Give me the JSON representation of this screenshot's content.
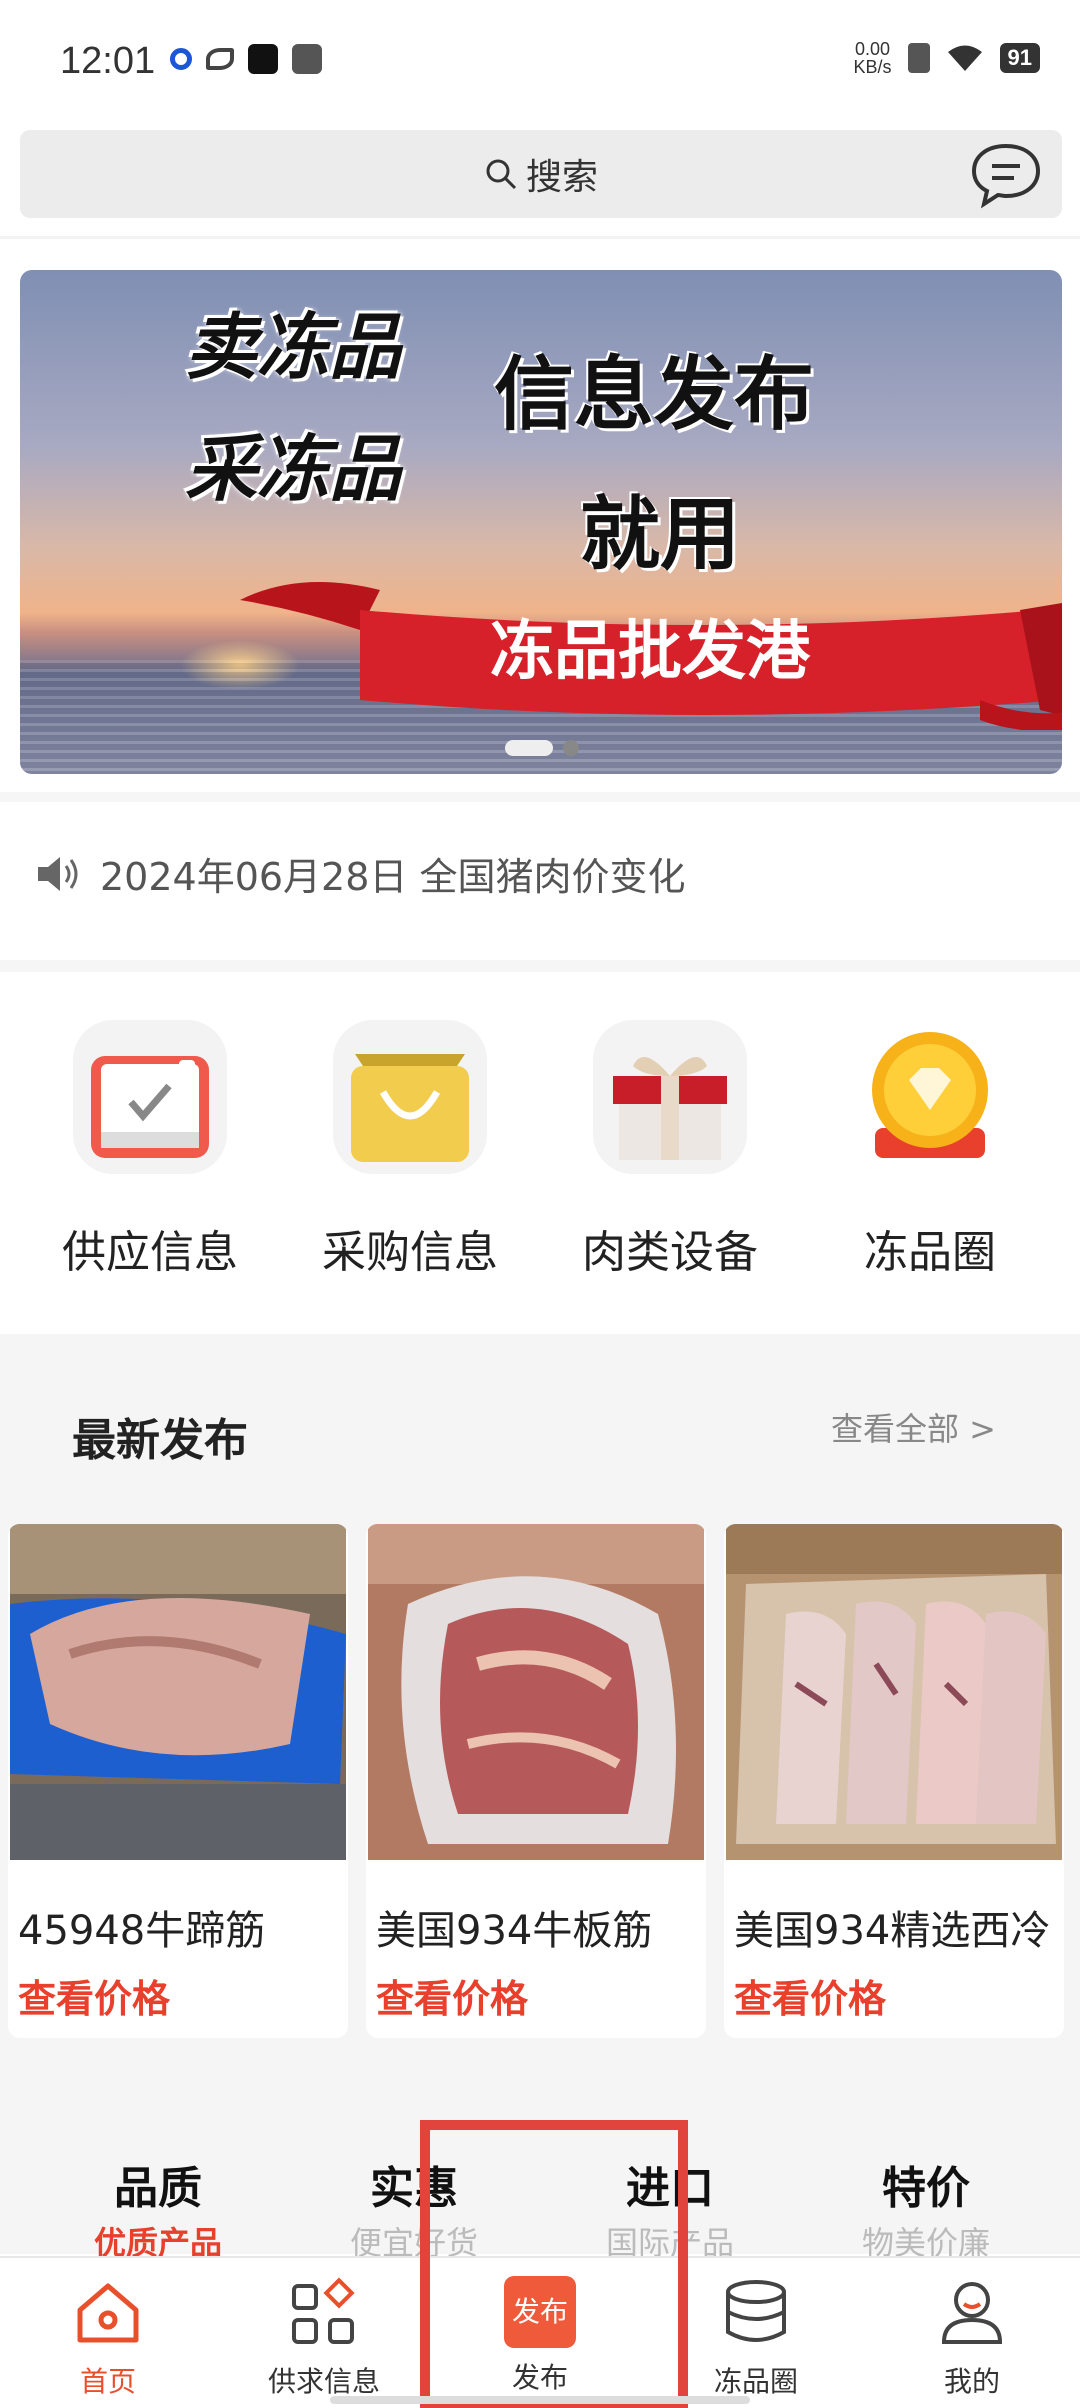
{
  "status_bar": {
    "time": "12:01",
    "net_speed_value": "0.00",
    "net_speed_unit": "KB/s",
    "battery": "91"
  },
  "search": {
    "placeholder": "搜索"
  },
  "banner": {
    "line1": "卖冻品",
    "line2": "采冻品",
    "line3": "信息发布",
    "line4": "就用",
    "ribbon": "冻品批发港"
  },
  "notice": {
    "text": "2024年06月28日 全国猪肉价变化"
  },
  "categories": [
    {
      "label": "供应信息",
      "icon": "calendar-check-icon"
    },
    {
      "label": "采购信息",
      "icon": "shopping-bag-icon"
    },
    {
      "label": "肉类设备",
      "icon": "gift-box-icon"
    },
    {
      "label": "冻品圈",
      "icon": "diamond-badge-icon"
    }
  ],
  "latest": {
    "title": "最新发布",
    "view_all": "查看全部 >",
    "items": [
      {
        "name": "45948牛蹄筋",
        "price_label": "查看价格"
      },
      {
        "name": "美国934牛板筋",
        "price_label": "查看价格"
      },
      {
        "name": "美国934精选西冷",
        "price_label": "查看价格"
      }
    ]
  },
  "tabs": [
    {
      "title": "品质",
      "sub": "优质产品"
    },
    {
      "title": "实惠",
      "sub": "便宜好货"
    },
    {
      "title": "进口",
      "sub": "国际产品"
    },
    {
      "title": "特价",
      "sub": "物美价廉"
    }
  ],
  "bottom_nav": [
    {
      "label": "首页",
      "icon": "home-icon"
    },
    {
      "label": "供求信息",
      "icon": "grid-icon"
    },
    {
      "label": "发布",
      "icon_text": "发布"
    },
    {
      "label": "冻品圈",
      "icon": "database-icon"
    },
    {
      "label": "我的",
      "icon": "user-icon"
    }
  ],
  "colors": {
    "accent": "#e8402c",
    "highlight": "#e0443c"
  }
}
